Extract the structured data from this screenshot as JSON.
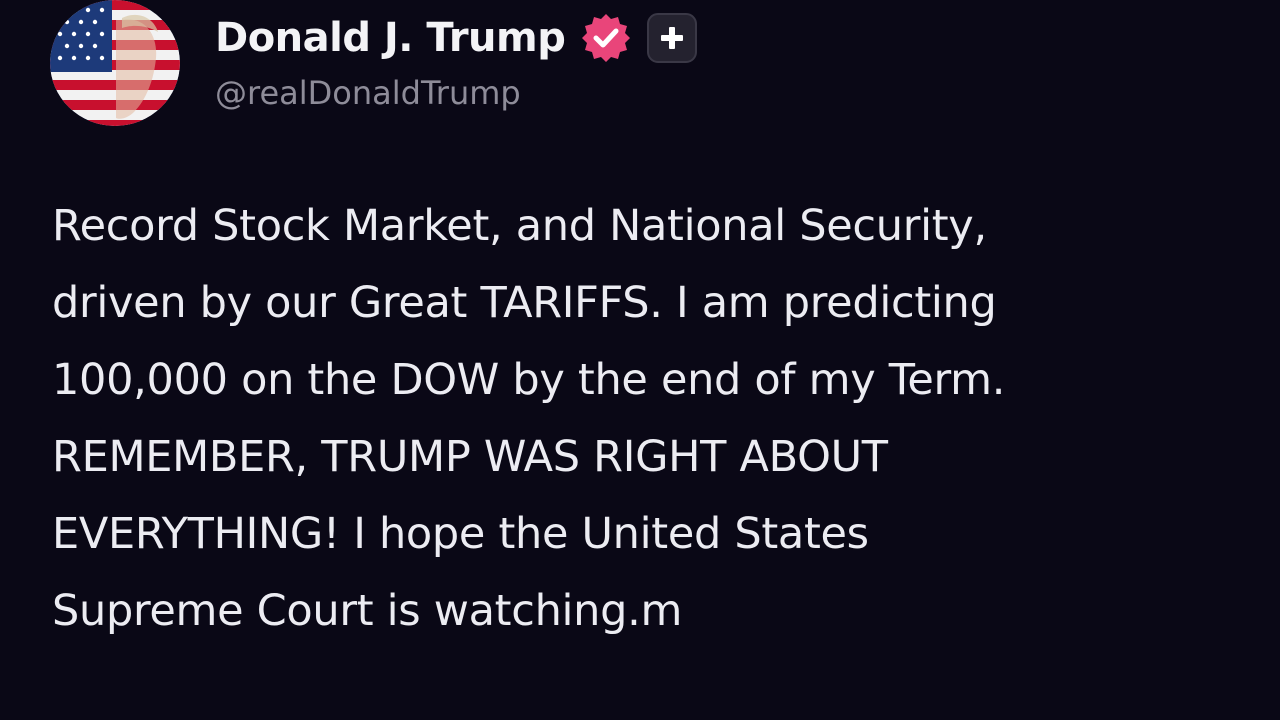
{
  "author": {
    "display_name": "Donald J. Trump",
    "handle": "@realDonaldTrump",
    "avatar_icon": "flag-portrait-avatar",
    "verified_icon": "verified-badge-icon",
    "verified_color": "#e9457a",
    "plus_icon": "plus-icon"
  },
  "post": {
    "lines": [
      "Record Stock Market, and National Security,",
      "driven by our Great TARIFFS. I am predicting",
      "100,000 on the DOW by the end of my Term.",
      "REMEMBER, TRUMP WAS RIGHT ABOUT",
      "EVERYTHING! I hope the United States",
      "Supreme Court is watching.m"
    ]
  },
  "colors": {
    "background": "#0a0816",
    "text": "#ececf2",
    "handle": "#8e8c99"
  }
}
